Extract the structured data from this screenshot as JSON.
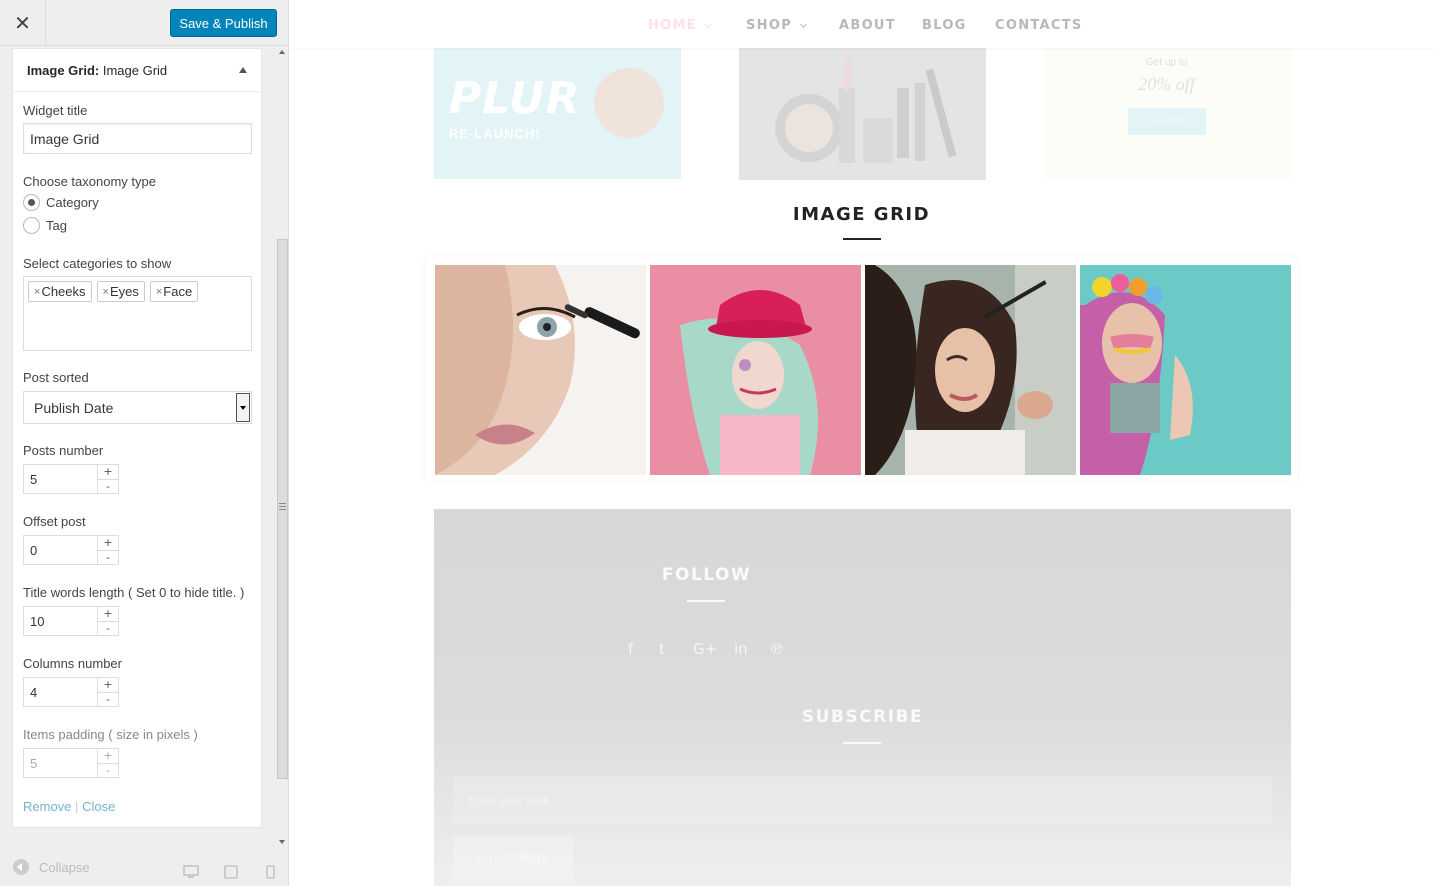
{
  "sidebar": {
    "close_icon": "close-icon",
    "publish_label": "Save & Publish",
    "widget": {
      "title_bold": "Image Grid:",
      "title_rest": " Image Grid",
      "widget_title_label": "Widget title",
      "widget_title_value": "Image Grid",
      "taxonomy_label": "Choose taxonomy type",
      "taxonomy_options": [
        "Category",
        "Tag"
      ],
      "taxonomy_selected": "Category",
      "categories_label": "Select categories to show",
      "categories": [
        "Cheeks",
        "Eyes",
        "Face"
      ],
      "tag_remove_glyph": "×",
      "post_sorted_label": "Post sorted",
      "post_sorted_value": "Publish Date",
      "posts_number_label": "Posts number",
      "posts_number_value": "5",
      "offset_label": "Offset post",
      "offset_value": "0",
      "title_length_label": "Title words length ( Set 0 to hide title. )",
      "title_length_value": "10",
      "columns_label": "Columns number",
      "columns_value": "4",
      "padding_label": "Items padding ( size in pixels )",
      "padding_value": "5",
      "spin_plus": "+",
      "spin_minus": "-",
      "remove_label": "Remove",
      "separator": "|",
      "close_label": "Close"
    },
    "footer": {
      "collapse_label": "Collapse",
      "devices": [
        "desktop-icon",
        "tablet-icon",
        "mobile-icon"
      ]
    }
  },
  "preview": {
    "nav": [
      "HOME",
      "SHOP",
      "ABOUT",
      "BLOG",
      "CONTACTS"
    ],
    "promo": {
      "p1_title": "PLUR",
      "p1_sub": "RE-LAUNCH!",
      "p1_link": "Shop now",
      "p3_pre": "Get up to",
      "p3_off": "20% off",
      "p3_btn": "SHOP NOW!"
    },
    "section_title": "IMAGE GRID",
    "follow_title": "FOLLOW",
    "social_icons": [
      "facebook-icon",
      "twitter-icon",
      "google-plus-icon",
      "linkedin-icon",
      "pinterest-icon"
    ],
    "social_glyphs": [
      "f",
      "t",
      "G+",
      "in",
      "℗"
    ],
    "subscribe_title": "SUBSCRIBE",
    "email_placeholder": "Enter your mail",
    "subscribe_button": "SUBSCRIBE"
  },
  "colors": {
    "publish": "#0085ba",
    "accent_pink": "#fde0e8",
    "heading": "#222222",
    "footer_bg": "#d7d7d7"
  }
}
